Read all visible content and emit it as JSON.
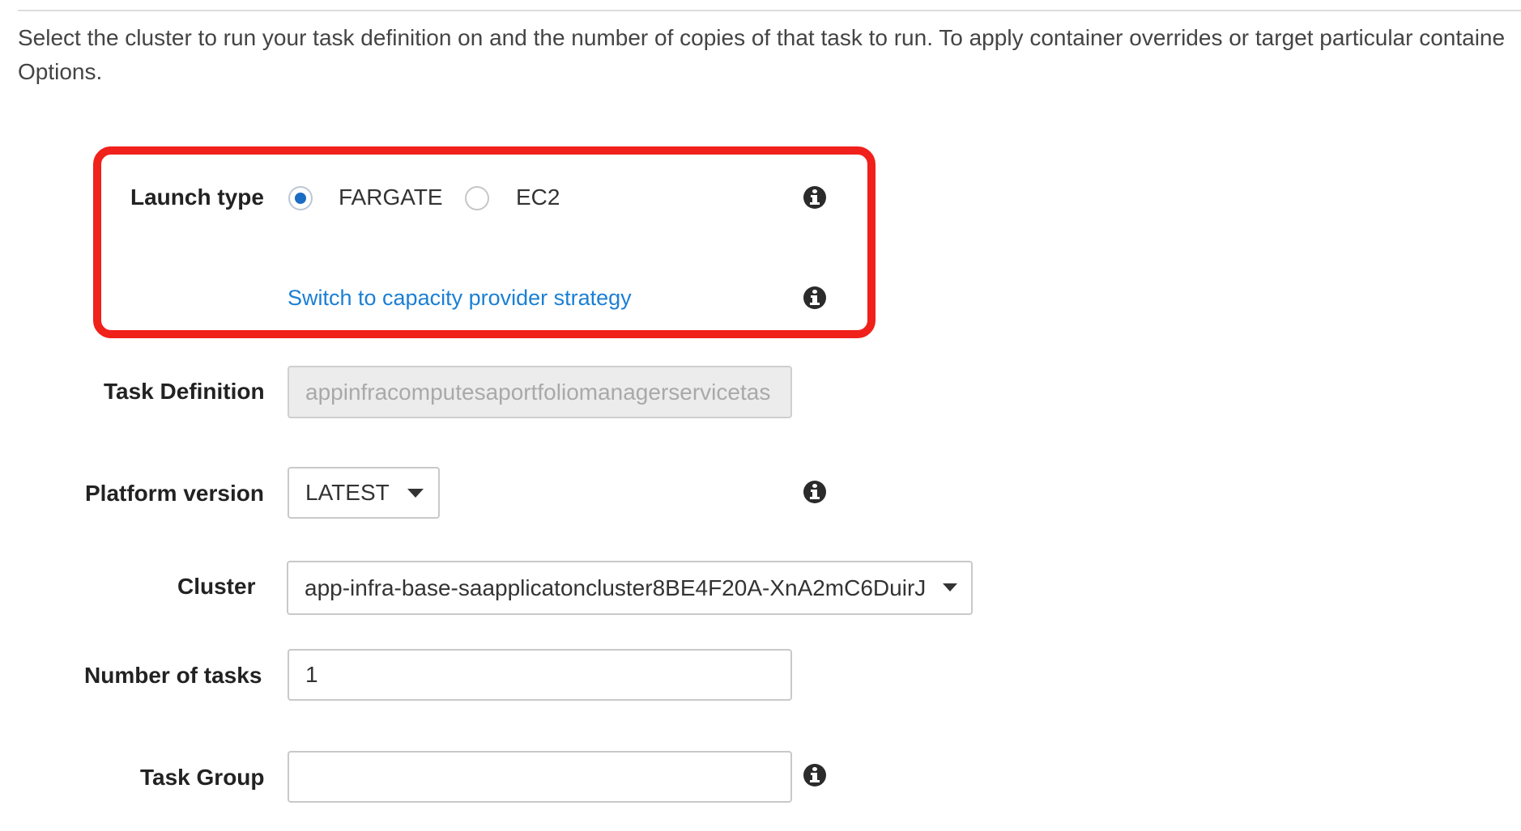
{
  "intro": {
    "line1": "Select the cluster to run your task definition on and the number of copies of that task to run. To apply container overrides or target particular containe",
    "line2": "Options."
  },
  "launch_type": {
    "label": "Launch type",
    "options": [
      {
        "label": "FARGATE",
        "selected": true
      },
      {
        "label": "EC2",
        "selected": false
      }
    ],
    "switch_link": "Switch to capacity provider strategy"
  },
  "task_definition": {
    "label": "Task Definition",
    "value": "appinfracomputesaportfoliomanagerservicetas"
  },
  "platform_version": {
    "label": "Platform version",
    "value": "LATEST"
  },
  "cluster": {
    "label": "Cluster",
    "value": "app-infra-base-saapplicatoncluster8BE4F20A-XnA2mC6DuirJ"
  },
  "number_of_tasks": {
    "label": "Number of tasks",
    "value": "1"
  },
  "task_group": {
    "label": "Task Group",
    "value": ""
  },
  "colors": {
    "highlight": "#f0201b",
    "link": "#1b7fd4",
    "radio_selected": "#1b6cc4"
  }
}
